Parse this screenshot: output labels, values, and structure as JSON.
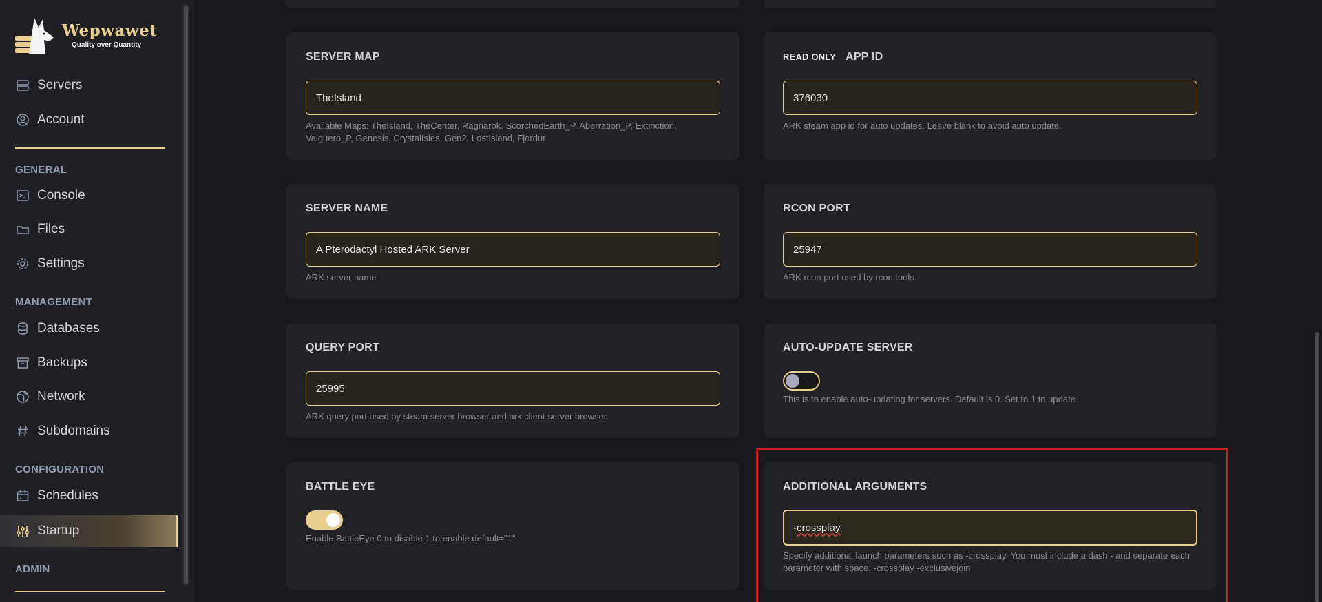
{
  "brand": {
    "name": "Wepwawet",
    "tagline": "Quality over Quantity"
  },
  "sidebar": {
    "top_items": [
      {
        "label": "Servers",
        "icon": "server-icon"
      },
      {
        "label": "Account",
        "icon": "account-icon"
      }
    ],
    "sections": [
      {
        "label": "GENERAL",
        "items": [
          {
            "label": "Console",
            "icon": "console-icon"
          },
          {
            "label": "Files",
            "icon": "folder-icon"
          },
          {
            "label": "Settings",
            "icon": "gear-icon"
          }
        ]
      },
      {
        "label": "MANAGEMENT",
        "items": [
          {
            "label": "Databases",
            "icon": "database-icon"
          },
          {
            "label": "Backups",
            "icon": "archive-icon"
          },
          {
            "label": "Network",
            "icon": "globe-icon"
          },
          {
            "label": "Subdomains",
            "icon": "hash-icon"
          }
        ]
      },
      {
        "label": "CONFIGURATION",
        "items": [
          {
            "label": "Schedules",
            "icon": "calendar-icon"
          },
          {
            "label": "Startup",
            "icon": "sliders-icon",
            "active": true
          }
        ]
      },
      {
        "label": "ADMIN",
        "items": []
      }
    ]
  },
  "cards": {
    "server_map": {
      "title": "SERVER MAP",
      "value": "TheIsland",
      "help": "Available Maps: TheIsland, TheCenter, Ragnarok, ScorchedEarth_P, Aberration_P, Extinction, Valguero_P, Genesis, CrystalIsles, Gen2, LostIsland, Fjordur"
    },
    "app_id": {
      "badge": "READ ONLY",
      "title": "APP ID",
      "value": "376030",
      "help": "ARK steam app id for auto updates. Leave blank to avoid auto update."
    },
    "server_name": {
      "title": "SERVER NAME",
      "value": "A Pterodactyl Hosted ARK Server",
      "help": "ARK server name"
    },
    "rcon_port": {
      "title": "RCON PORT",
      "value": "25947",
      "help": "ARK rcon port used by rcon tools."
    },
    "query_port": {
      "title": "QUERY PORT",
      "value": "25995",
      "help": "ARK query port used by steam server browser and ark client server browser."
    },
    "auto_update": {
      "title": "AUTO-UPDATE SERVER",
      "enabled": false,
      "help": "This is to enable auto-updating for servers. Default is 0. Set to 1 to update"
    },
    "battle_eye": {
      "title": "BATTLE EYE",
      "enabled": true,
      "help": "Enable BattleEye 0 to disable 1 to enable default=\"1\""
    },
    "additional_args": {
      "title": "ADDITIONAL ARGUMENTS",
      "value_prefix": "-",
      "value_word": "crossplay",
      "help": "Specify additional launch parameters such as -crossplay. You must include a dash - and separate each parameter with space: -crossplay -exclusivejoin"
    }
  },
  "colors": {
    "accent": "#e8cf8f",
    "background": "#18181b",
    "card": "#222226",
    "highlight": "#c81e1e"
  }
}
